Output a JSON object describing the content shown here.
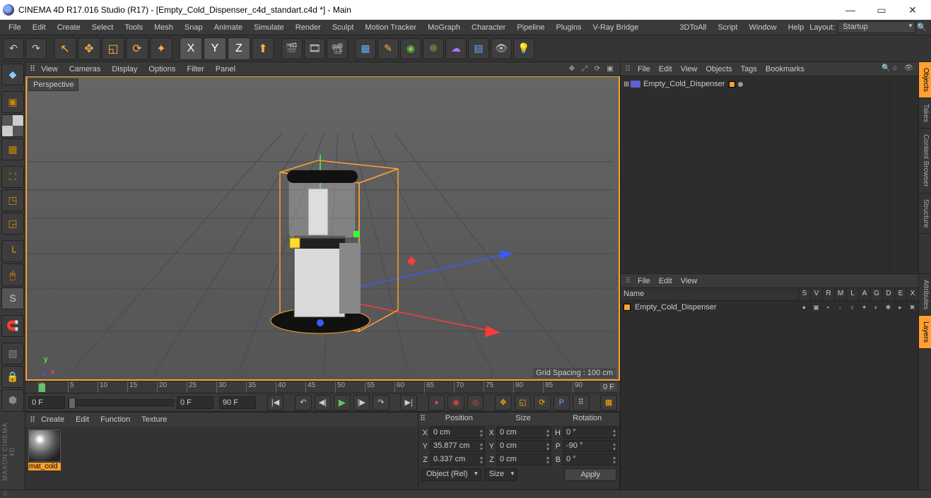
{
  "title": "CINEMA 4D R17.016 Studio (R17) - [Empty_Cold_Dispenser_c4d_standart.c4d *] - Main",
  "menu": [
    "File",
    "Edit",
    "Create",
    "Select",
    "Tools",
    "Mesh",
    "Snap",
    "Animate",
    "Simulate",
    "Render",
    "Sculpt",
    "Motion Tracker",
    "MoGraph",
    "Character",
    "Pipeline",
    "Plugins",
    "V-Ray Bridge",
    "3DToAll",
    "Script",
    "Window",
    "Help"
  ],
  "layout_label": "Layout:",
  "layout_value": "Startup",
  "view_menu": [
    "View",
    "Cameras",
    "Display",
    "Options",
    "Filter",
    "Panel"
  ],
  "perspective_label": "Perspective",
  "grid_spacing": "Grid Spacing : 100 cm",
  "ruler_ticks": [
    "0",
    "5",
    "10",
    "15",
    "20",
    "25",
    "30",
    "35",
    "40",
    "45",
    "50",
    "55",
    "60",
    "65",
    "70",
    "75",
    "80",
    "85",
    "90"
  ],
  "ruler_end": "0 F",
  "timebar": {
    "start": "0 F",
    "cur": "0 F",
    "end": "90 F"
  },
  "mat_menu": [
    "Create",
    "Edit",
    "Function",
    "Texture"
  ],
  "material_name": "mat_cold",
  "coord_hdr": [
    "Position",
    "Size",
    "Rotation"
  ],
  "coord": {
    "labels": [
      "X",
      "Y",
      "Z"
    ],
    "pos": [
      "0 cm",
      "35.877 cm",
      "0.337 cm"
    ],
    "size_labels": [
      "X",
      "Y",
      "Z"
    ],
    "size": [
      "0 cm",
      "0 cm",
      "0 cm"
    ],
    "rot_labels": [
      "H",
      "P",
      "B"
    ],
    "rot": [
      "0 °",
      "-90 °",
      "0 °"
    ],
    "mode": "Object (Rel)",
    "size_mode": "Size",
    "apply": "Apply"
  },
  "obj_menu": [
    "File",
    "Edit",
    "View",
    "Objects",
    "Tags",
    "Bookmarks"
  ],
  "object_name": "Empty_Cold_Dispenser",
  "layer_menu": [
    "File",
    "Edit",
    "View"
  ],
  "layer_hdr_name": "Name",
  "layer_cols": [
    "S",
    "V",
    "R",
    "M",
    "L",
    "A",
    "G",
    "D",
    "E",
    "X"
  ],
  "layer_name": "Empty_Cold_Dispenser",
  "right_tabs_top": [
    "Objects",
    "Takes",
    "Content Browser",
    "Structure"
  ],
  "right_tabs_bottom": [
    "Attributes",
    "Layers"
  ],
  "maxon": "MAXON CINEMA 4D"
}
